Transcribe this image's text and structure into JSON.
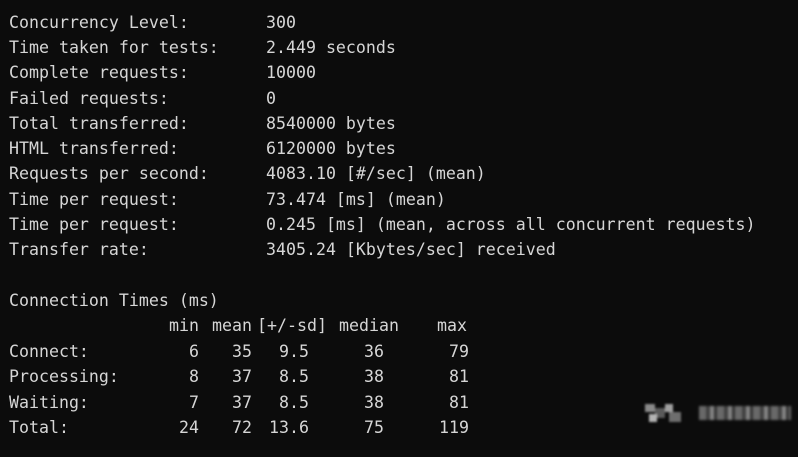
{
  "summary": [
    {
      "label": "Concurrency Level:",
      "value": "300"
    },
    {
      "label": "Time taken for tests:",
      "value": "2.449 seconds"
    },
    {
      "label": "Complete requests:",
      "value": "10000"
    },
    {
      "label": "Failed requests:",
      "value": "0"
    },
    {
      "label": "Total transferred:",
      "value": "8540000 bytes"
    },
    {
      "label": "HTML transferred:",
      "value": "6120000 bytes"
    },
    {
      "label": "Requests per second:",
      "value": "4083.10 [#/sec] (mean)"
    },
    {
      "label": "Time per request:",
      "value": "73.474 [ms] (mean)"
    },
    {
      "label": "Time per request:",
      "value": "0.245 [ms] (mean, across all concurrent requests)"
    },
    {
      "label": "Transfer rate:",
      "value": "3405.24 [Kbytes/sec] received"
    }
  ],
  "connection_times": {
    "title": "Connection Times (ms)",
    "headers": {
      "min": "min",
      "mean": "mean",
      "sd": "[+/-sd]",
      "median": "median",
      "max": "max"
    },
    "rows": [
      {
        "label": "Connect:",
        "min": "6",
        "mean": "35",
        "sd": "9.5",
        "median": "36",
        "max": "79"
      },
      {
        "label": "Processing:",
        "min": "8",
        "mean": "37",
        "sd": "8.5",
        "median": "38",
        "max": "81"
      },
      {
        "label": "Waiting:",
        "min": "7",
        "mean": "37",
        "sd": "8.5",
        "median": "38",
        "max": "81"
      },
      {
        "label": "Total:",
        "min": "24",
        "mean": "72",
        "sd": "13.6",
        "median": "75",
        "max": "119"
      }
    ]
  },
  "colors": {
    "background": "#0c0c0c",
    "text": "#d6d6d6"
  }
}
